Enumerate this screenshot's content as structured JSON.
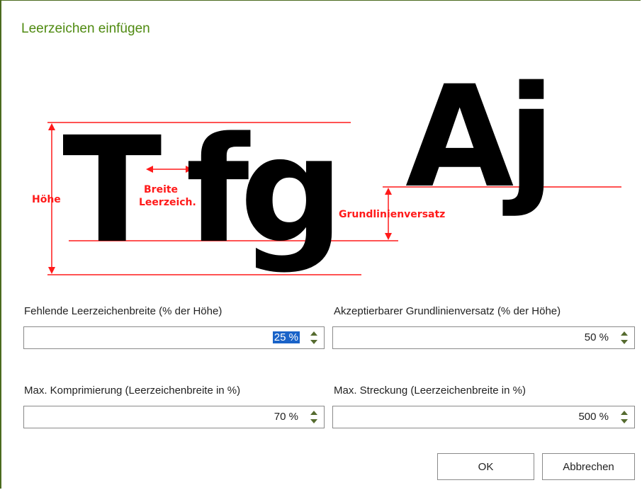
{
  "dialog": {
    "title": "Leerzeichen einfügen"
  },
  "diagram": {
    "letters_left": [
      "T",
      "f",
      "g"
    ],
    "letters_right": [
      "A",
      "j"
    ],
    "labels": {
      "height": "Höhe",
      "space_width_line1": "Breite",
      "space_width_line2": "Leerzeich.",
      "baseline_offset": "Grundlinienversatz"
    },
    "colors": {
      "annotation": "#ff1a1a",
      "glyph": "#000000"
    }
  },
  "fields": {
    "missing_space_width": {
      "label": "Fehlende Leerzeichenbreite (% der Höhe)",
      "value": "25 %"
    },
    "acceptable_baseline_offset": {
      "label": "Akzeptierbarer Grundlinienversatz (% der Höhe)",
      "value": "50 %"
    },
    "max_compression": {
      "label": "Max. Komprimierung (Leerzeichenbreite in %)",
      "value": "70 %"
    },
    "max_stretch": {
      "label": "Max. Streckung (Leerzeichenbreite in %)",
      "value": "500 %"
    }
  },
  "buttons": {
    "ok": "OK",
    "cancel": "Abbrechen"
  },
  "colors": {
    "title": "#4f8a10",
    "spinner": "#556b2f",
    "selection": "#1a63c8"
  }
}
